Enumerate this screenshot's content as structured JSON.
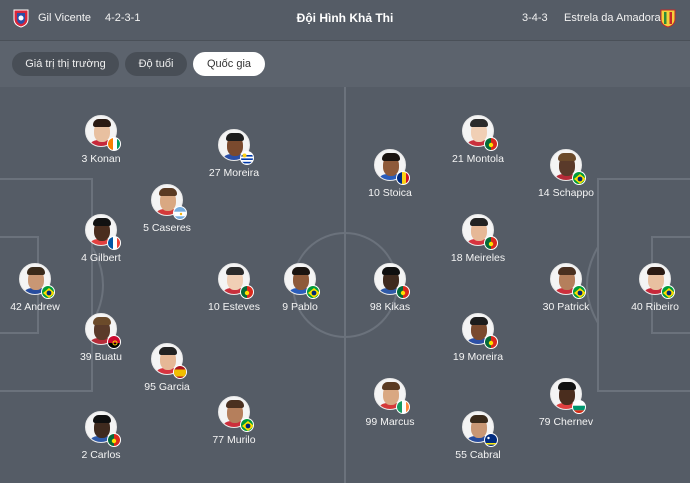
{
  "header": {
    "home_team": "Gil Vicente",
    "home_formation": "4-2-3-1",
    "title": "Đội Hình Khả Thi",
    "away_formation": "3-4-3",
    "away_team": "Estrela da Amadora"
  },
  "tabs": [
    {
      "label": "Giá trị thị trường",
      "active": false
    },
    {
      "label": "Độ tuổi",
      "active": false
    },
    {
      "label": "Quốc gia",
      "active": true
    }
  ],
  "home_players": [
    {
      "label": "3 Konan",
      "flag": "ivory-coast"
    },
    {
      "label": "27 Moreira",
      "flag": "uruguay"
    },
    {
      "label": "5 Caseres",
      "flag": "argentina"
    },
    {
      "label": "4 Gilbert",
      "flag": "france"
    },
    {
      "label": "42 Andrew",
      "flag": "brazil"
    },
    {
      "label": "10 Esteves",
      "flag": "portugal"
    },
    {
      "label": "9 Pablo",
      "flag": "brazil"
    },
    {
      "label": "39 Buatu",
      "flag": "angola"
    },
    {
      "label": "95 Garcia",
      "flag": "spain"
    },
    {
      "label": "2 Carlos",
      "flag": "portugal"
    },
    {
      "label": "77 Murilo",
      "flag": "brazil"
    }
  ],
  "away_players": [
    {
      "label": "21 Montola",
      "flag": "portugal"
    },
    {
      "label": "10 Stoica",
      "flag": "romania"
    },
    {
      "label": "14 Schappo",
      "flag": "brazil"
    },
    {
      "label": "18 Meireles",
      "flag": "portugal"
    },
    {
      "label": "98 Kikas",
      "flag": "portugal"
    },
    {
      "label": "30 Patrick",
      "flag": "brazil"
    },
    {
      "label": "40 Ribeiro",
      "flag": "brazil"
    },
    {
      "label": "19 Moreira",
      "flag": "portugal"
    },
    {
      "label": "99 Marcus",
      "flag": "ireland"
    },
    {
      "label": "79 Chernev",
      "flag": "bulgaria"
    },
    {
      "label": "55 Cabral",
      "flag": "curacao"
    }
  ],
  "colors": {
    "background": "#555c66",
    "tab_bg": "#484e56",
    "tab_active_bg": "#ffffff",
    "pitch_lines": "#6b727c"
  }
}
